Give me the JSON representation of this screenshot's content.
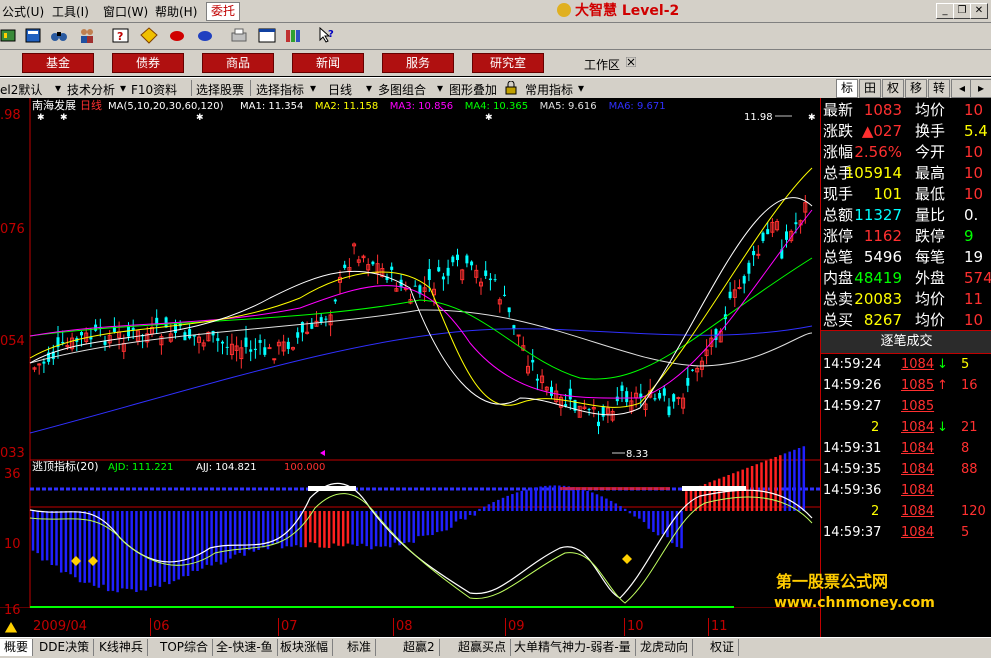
{
  "menu": {
    "items": [
      "公式(U)",
      "工具(I)",
      "窗口(W)",
      "帮助(H)"
    ],
    "entrust": "委托",
    "logo": "大智慧 Level-2"
  },
  "nav": {
    "buttons": [
      "基金",
      "债券",
      "商品",
      "新闻",
      "服务",
      "研究室"
    ],
    "workspace": "工作区"
  },
  "funcbar": {
    "items": [
      "el2默认",
      "技术分析",
      "F10资料",
      "选择股票",
      "选择指标",
      "日线",
      "多图组合",
      "图形叠加",
      "常用指标"
    ],
    "tabs": [
      "标",
      "田",
      "权",
      "移",
      "转"
    ]
  },
  "chart": {
    "stock": "南海发展",
    "period": "日线",
    "ma_header": "MA(5,10,20,30,60,120)",
    "ma_values": [
      {
        "label": "MA1:",
        "value": "11.354",
        "color": "#ffffff"
      },
      {
        "label": "MA2:",
        "value": "11.158",
        "color": "#ffff00"
      },
      {
        "label": "MA3:",
        "value": "10.856",
        "color": "#ff00ff"
      },
      {
        "label": "MA4:",
        "value": "10.365",
        "color": "#00ff00"
      },
      {
        "label": "MA5:",
        "value": "9.616",
        "color": "#e0e0e0"
      },
      {
        "label": "MA6:",
        "value": "9.671",
        "color": "#3030ff"
      }
    ],
    "high_label": "11.98",
    "low_label": "8.33",
    "y_labels": [
      ".98",
      "076",
      "054",
      "033"
    ],
    "indicator": {
      "name": "逃顶指标(20)",
      "ajd": "AJD: 111.221",
      "ajj": "AJJ: 104.821",
      "level": "100.000",
      "y_labels": [
        "36",
        "10",
        "16"
      ]
    },
    "dates": [
      "2009/04",
      "06",
      "07",
      "08",
      "09",
      "10",
      "11"
    ]
  },
  "quote": {
    "rows": [
      {
        "l1": "最新",
        "v1": "1083",
        "c1": "#ff3030",
        "l2": "均价",
        "v2": "10",
        "c2": "#ff3030"
      },
      {
        "l1": "涨跌",
        "v1": "▲027",
        "c1": "#ff3030",
        "l2": "换手",
        "v2": "5.4",
        "c2": "#ffff00"
      },
      {
        "l1": "涨幅",
        "v1": "2.56%",
        "c1": "#ff3030",
        "l2": "今开",
        "v2": "10",
        "c2": "#ff3030"
      },
      {
        "l1": "总手",
        "v1": "105914",
        "c1": "#ffff00",
        "l2": "最高",
        "v2": "10",
        "c2": "#ff3030"
      },
      {
        "l1": "现手",
        "v1": "101",
        "c1": "#ffff00",
        "l2": "最低",
        "v2": "10",
        "c2": "#ff3030"
      },
      {
        "l1": "总额",
        "v1": "11327",
        "c1": "#00ffff",
        "l2": "量比",
        "v2": "0.",
        "c2": "#ffffff"
      },
      {
        "l1": "涨停",
        "v1": "1162",
        "c1": "#ff3030",
        "l2": "跌停",
        "v2": "9",
        "c2": "#00ff00"
      },
      {
        "l1": "总笔",
        "v1": "5496",
        "c1": "#ffffff",
        "l2": "每笔",
        "v2": "19",
        "c2": "#ffffff"
      },
      {
        "l1": "内盘",
        "v1": "48419",
        "c1": "#00ff00",
        "l2": "外盘",
        "v2": "574",
        "c2": "#ff3030"
      },
      {
        "l1": "总卖",
        "v1": "20083",
        "c1": "#ffff00",
        "l2": "均价",
        "v2": "11",
        "c2": "#ff3030"
      },
      {
        "l1": "总买",
        "v1": "8267",
        "c1": "#ffff00",
        "l2": "均价",
        "v2": "10",
        "c2": "#ff3030"
      }
    ],
    "tick_header": "逐笔成交",
    "ticks": [
      {
        "time": "14:59:24",
        "price": "1084",
        "arrow": "↓",
        "acolor": "#00ff00",
        "vol": "5",
        "vcolor": "#ffff00"
      },
      {
        "time": "14:59:26",
        "price": "1085",
        "arrow": "↑",
        "acolor": "#ff3030",
        "vol": "16",
        "vcolor": "#ff3030"
      },
      {
        "time": "14:59:27",
        "price": "1085",
        "arrow": "",
        "acolor": "#ff3030",
        "vol": "",
        "vcolor": "#ff3030"
      },
      {
        "time": "2",
        "price": "1084",
        "arrow": "↓",
        "acolor": "#00ff00",
        "vol": "21",
        "vcolor": "#ff3030"
      },
      {
        "time": "14:59:31",
        "price": "1084",
        "arrow": "",
        "acolor": "#ff3030",
        "vol": "8",
        "vcolor": "#ff3030"
      },
      {
        "time": "14:59:35",
        "price": "1084",
        "arrow": "",
        "acolor": "#ff3030",
        "vol": "88",
        "vcolor": "#ff3030"
      },
      {
        "time": "14:59:36",
        "price": "1084",
        "arrow": "",
        "acolor": "#ff3030",
        "vol": "",
        "vcolor": "#ff3030"
      },
      {
        "time": "2",
        "price": "1084",
        "arrow": "",
        "acolor": "#ff3030",
        "vol": "120",
        "vcolor": "#ff3030"
      },
      {
        "time": "14:59:37",
        "price": "1084",
        "arrow": "",
        "acolor": "#ff3030",
        "vol": "5",
        "vcolor": "#ff3030"
      }
    ]
  },
  "watermark": {
    "text": "第一股票公式网",
    "url": "www.chnmoney.com"
  },
  "bottom_tabs": [
    "概要",
    "DDE决策",
    "K线神兵",
    "TOP综合",
    "全-快速-鱼",
    "板块涨幅",
    "标准",
    "超赢2",
    "超赢买点",
    "大单精气神力-弱者-量",
    "龙虎动向",
    "权证"
  ]
}
